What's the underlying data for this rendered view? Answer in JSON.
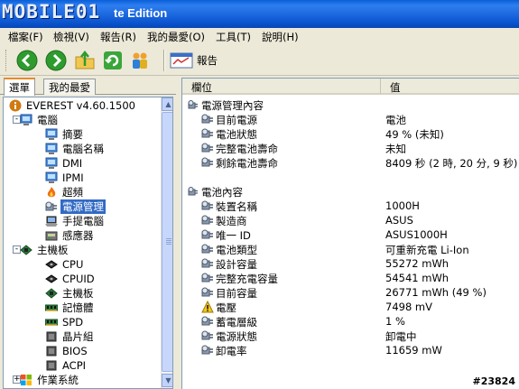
{
  "title": {
    "logo": "MOBILE01",
    "title_suffix": "te Edition"
  },
  "menu": [
    {
      "label": "檔案(F)"
    },
    {
      "label": "檢視(V)"
    },
    {
      "label": "報告(R)"
    },
    {
      "label": "我的最愛(O)"
    },
    {
      "label": "工具(T)"
    },
    {
      "label": "說明(H)"
    }
  ],
  "toolbar": {
    "report_label": "報告"
  },
  "tabs": [
    {
      "label": "選單"
    },
    {
      "label": "我的最愛"
    }
  ],
  "tree": [
    {
      "label": "EVEREST v4.60.1500",
      "icon": "info-icon",
      "level": 0,
      "expander": ""
    },
    {
      "label": "電腦",
      "icon": "computer-icon",
      "level": 1,
      "expander": "-"
    },
    {
      "label": "摘要",
      "icon": "computer-icon",
      "level": 2,
      "expander": ""
    },
    {
      "label": "電腦名稱",
      "icon": "computer-icon",
      "level": 2,
      "expander": ""
    },
    {
      "label": "DMI",
      "icon": "computer-icon",
      "level": 2,
      "expander": ""
    },
    {
      "label": "IPMI",
      "icon": "computer-icon",
      "level": 2,
      "expander": ""
    },
    {
      "label": "超頻",
      "icon": "flame-icon",
      "level": 2,
      "expander": ""
    },
    {
      "label": "電源管理",
      "icon": "power-icon",
      "level": 2,
      "expander": "",
      "selected": true
    },
    {
      "label": "手提電腦",
      "icon": "laptop-icon",
      "level": 2,
      "expander": ""
    },
    {
      "label": "感應器",
      "icon": "sensor-icon",
      "level": 2,
      "expander": ""
    },
    {
      "label": "主機板",
      "icon": "motherboard-icon",
      "level": 1,
      "expander": "-"
    },
    {
      "label": "CPU",
      "icon": "chip-icon",
      "level": 2,
      "expander": ""
    },
    {
      "label": "CPUID",
      "icon": "chip-icon",
      "level": 2,
      "expander": ""
    },
    {
      "label": "主機板",
      "icon": "motherboard-icon",
      "level": 2,
      "expander": ""
    },
    {
      "label": "記憶體",
      "icon": "memory-icon",
      "level": 2,
      "expander": ""
    },
    {
      "label": "SPD",
      "icon": "memory-icon",
      "level": 2,
      "expander": ""
    },
    {
      "label": "晶片組",
      "icon": "chipset-icon",
      "level": 2,
      "expander": ""
    },
    {
      "label": "BIOS",
      "icon": "chipset-icon",
      "level": 2,
      "expander": ""
    },
    {
      "label": "ACPI",
      "icon": "chipset-icon",
      "level": 2,
      "expander": ""
    },
    {
      "label": "作業系統",
      "icon": "windows-icon",
      "level": 1,
      "expander": "+"
    }
  ],
  "columns": {
    "field": "欄位",
    "value": "值"
  },
  "rows": [
    {
      "type": "group",
      "label": "電源管理內容"
    },
    {
      "type": "item",
      "field": "目前電源",
      "value": "電池",
      "icon": "power-icon"
    },
    {
      "type": "item",
      "field": "電池狀態",
      "value": "49 % (未知)",
      "icon": "power-icon"
    },
    {
      "type": "item",
      "field": "完整電池壽命",
      "value": "未知",
      "icon": "power-icon"
    },
    {
      "type": "item",
      "field": "剩餘電池壽命",
      "value": "8409 秒 (2 時, 20 分, 9 秒)",
      "icon": "power-icon"
    },
    {
      "type": "blank"
    },
    {
      "type": "group",
      "label": "電池內容"
    },
    {
      "type": "item",
      "field": "裝置名稱",
      "value": "1000H",
      "icon": "power-icon"
    },
    {
      "type": "item",
      "field": "製造商",
      "value": "ASUS",
      "icon": "power-icon"
    },
    {
      "type": "item",
      "field": "唯一 ID",
      "value": "ASUS1000H",
      "icon": "power-icon"
    },
    {
      "type": "item",
      "field": "電池類型",
      "value": "可重新充電 Li-Ion",
      "icon": "power-icon"
    },
    {
      "type": "item",
      "field": "設計容量",
      "value": "55272 mWh",
      "icon": "power-icon"
    },
    {
      "type": "item",
      "field": "完整充電容量",
      "value": "54541 mWh",
      "icon": "power-icon"
    },
    {
      "type": "item",
      "field": "目前容量",
      "value": "26771 mWh  (49 %)",
      "icon": "power-icon"
    },
    {
      "type": "item",
      "field": "電壓",
      "value": "7498 mV",
      "icon": "warning-icon"
    },
    {
      "type": "item",
      "field": "蓄電層級",
      "value": "1 %",
      "icon": "power-icon"
    },
    {
      "type": "item",
      "field": "電源狀態",
      "value": "卸電中",
      "icon": "power-icon"
    },
    {
      "type": "item",
      "field": "卸電率",
      "value": "11659 mW",
      "icon": "power-icon"
    }
  ],
  "watermark": "#23824"
}
